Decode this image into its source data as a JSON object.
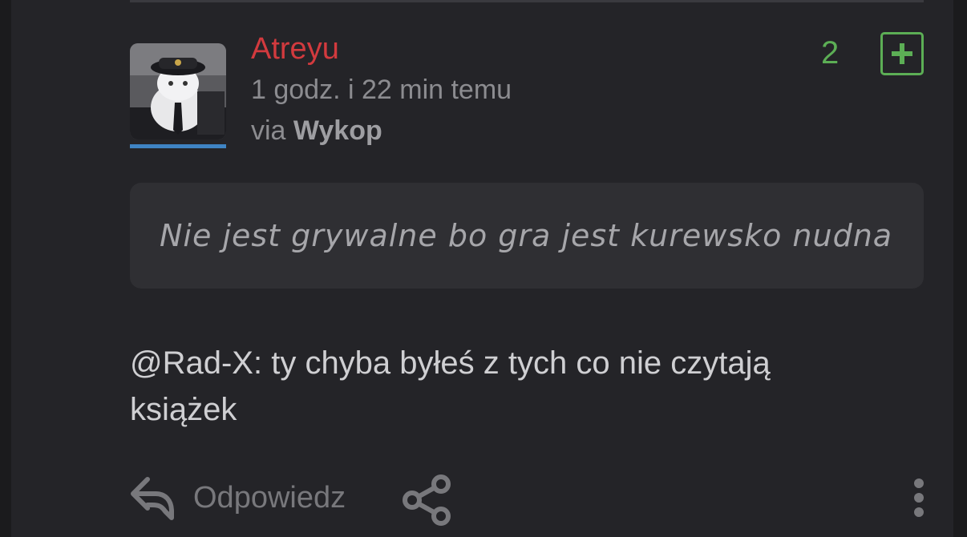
{
  "comment": {
    "author": "Atreyu",
    "time": "1 godz. i 22 min temu",
    "via_prefix": "via ",
    "via_source": "Wykop",
    "votes": "2",
    "quote": "Nie jest grywalne bo gra jest kurewsko nudna",
    "mention": "@Rad-X",
    "body": ": ty chyba byłeś z tych co nie czytają książek"
  },
  "actions": {
    "reply_label": "Odpowiedz"
  },
  "colors": {
    "author": "#d23a3e",
    "vote_accent": "#5cae55",
    "avatar_bar": "#3f84c4",
    "background": "#242428"
  },
  "icons": [
    "plus-icon",
    "reply-icon",
    "share-icon",
    "more-vertical-icon"
  ]
}
